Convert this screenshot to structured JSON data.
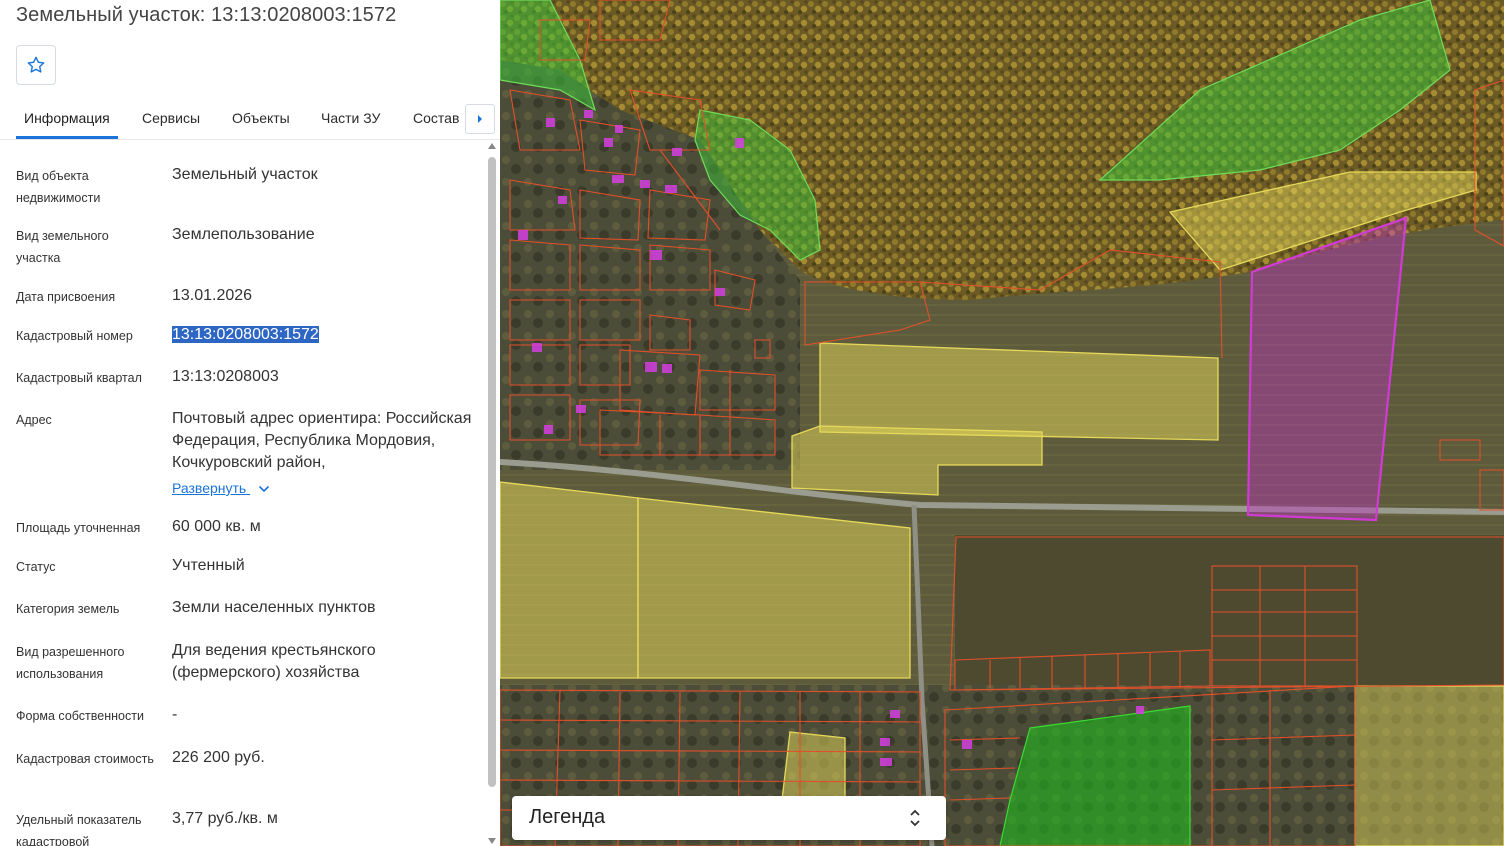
{
  "panel": {
    "title": "Земельный участок: 13:13:0208003:1572",
    "tabs": [
      {
        "label": "Информация"
      },
      {
        "label": "Сервисы"
      },
      {
        "label": "Объекты"
      },
      {
        "label": "Части ЗУ"
      },
      {
        "label": "Состав"
      }
    ],
    "fields": [
      {
        "label": "Вид объекта недвижимости",
        "value": "Земельный участок"
      },
      {
        "label": "Вид земельного участка",
        "value": "Землепользование"
      },
      {
        "label": "Дата присвоения",
        "value": "13.01.2026"
      },
      {
        "label": "Кадастровый номер",
        "value": "13:13:0208003:1572"
      },
      {
        "label": "Кадастровый квартал",
        "value": "13:13:0208003"
      },
      {
        "label": "Адрес",
        "value": "Почтовый адрес ориентира: Российская Федерация, Республика Мордовия, Кочкуровский район,"
      },
      {
        "label": "Площадь уточненная",
        "value": "60 000 кв. м"
      },
      {
        "label": "Статус",
        "value": "Учтенный"
      },
      {
        "label": "Категория земель",
        "value": "Земли населенных пунктов"
      },
      {
        "label": "Вид разрешенного использования",
        "value": "Для ведения крестьянского (фермерского) хозяйства"
      },
      {
        "label": "Форма собственности",
        "value": "-"
      },
      {
        "label": "Кадастровая стоимость",
        "value": "226 200 руб."
      },
      {
        "label": "Удельный показатель кадастровой",
        "value": "3,77 руб./кв. м"
      }
    ],
    "expand_label": "Развернуть"
  },
  "map": {
    "legend_label": "Легенда",
    "colors": {
      "selected_parcel": "#c32fc8",
      "parcel_border": "#e2502a",
      "yellow_zone": "#e6d95a",
      "green_zone": "#3cc13a",
      "accent": "#1a73d9"
    }
  },
  "icons": {
    "favorite": "star-outline-icon",
    "tab_next": "caret-right-icon",
    "expand": "chevron-down-icon",
    "legend_toggle": "updown-chevron-icon"
  }
}
